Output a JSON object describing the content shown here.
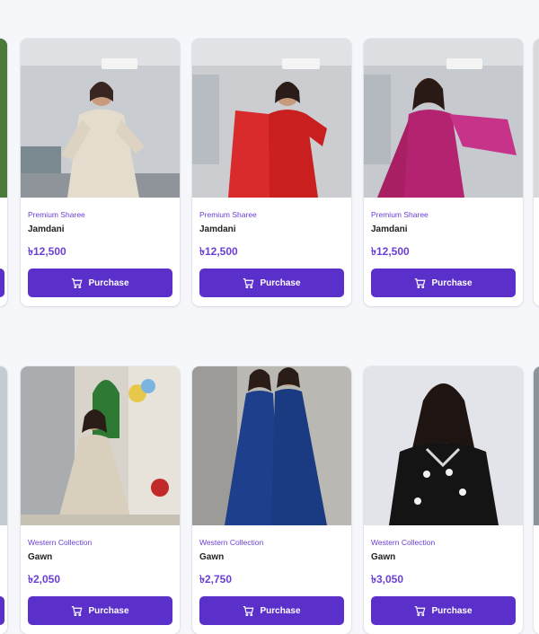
{
  "products": [
    {
      "category": "Premium Sharee",
      "name": "Jamdani",
      "price": "৳12,500",
      "button": "Purchase"
    },
    {
      "category": "Premium Sharee",
      "name": "Jamdani",
      "price": "৳12,500",
      "button": "Purchase"
    },
    {
      "category": "Premium Sharee",
      "name": "Jamdani",
      "price": "৳12,500",
      "button": "Purchase"
    },
    {
      "category": "Western Collection",
      "name": "Gawn",
      "price": "৳2,050",
      "button": "Purchase"
    },
    {
      "category": "Western Collection",
      "name": "Gawn",
      "price": "৳2,750",
      "button": "Purchase"
    },
    {
      "category": "Western Collection",
      "name": "Gawn",
      "price": "৳3,050",
      "button": "Purchase"
    }
  ],
  "colors": {
    "accent": "#5b2fc9",
    "category_text": "#6a3fd6",
    "background": "#f6f7fb"
  },
  "icons": {
    "button_icon": "cart-icon"
  }
}
